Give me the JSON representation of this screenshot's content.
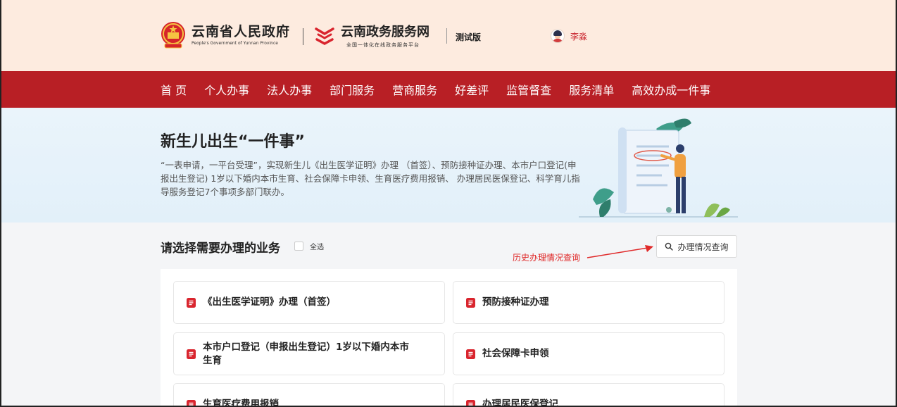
{
  "header": {
    "gov_name": "云南省人民政府",
    "gov_name_en": "People's Government of Yunnan Province",
    "portal_name": "云南政务服务网",
    "portal_sub": "全国一体化在线政务服务平台",
    "beta_label": "测试版",
    "user_name": "李淼"
  },
  "nav": {
    "items": [
      "首 页",
      "个人办事",
      "法人办事",
      "部门服务",
      "营商服务",
      "好差评",
      "监管督查",
      "服务清单",
      "高效办成一件事"
    ]
  },
  "banner": {
    "title": "新生儿出生“一件事”",
    "description": "“一表申请，一平台受理”，实现新生儿《出生医学证明》办理 （首签）、预防接种证办理、本市户口登记(申报出生登记) 1岁以下婚内本市生育、社会保障卡申领、生育医疗费用报销、 办理居民医保登记、科学育儿指导服务登记7个事项多部门联办。"
  },
  "content": {
    "section_title": "请选择需要办理的业务",
    "select_all_label": "全选",
    "history_button": "办理情况查询",
    "annotation": "历史办理情况查询",
    "services": [
      "《出生医学证明》办理（首签）",
      "预防接种证办理",
      "本市户口登记（申报出生登记）1岁以下婚内本市生育",
      "社会保障卡申领",
      "生育医疗费用报销",
      "办理居民医保登记"
    ]
  },
  "colors": {
    "header_bg": "#fdebdf",
    "nav_bg": "#b81f25",
    "accent_red": "#e02a2a",
    "icon_red": "#d9252e"
  }
}
